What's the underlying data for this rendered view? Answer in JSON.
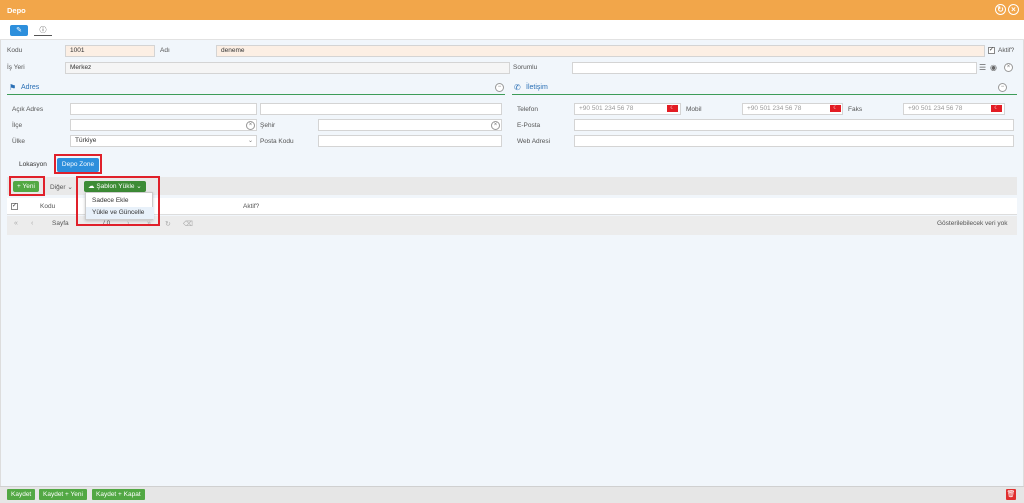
{
  "window": {
    "title": "Depo"
  },
  "form": {
    "kodu_label": "Kodu",
    "kodu_value": "1001",
    "adi_label": "Adı",
    "adi_value": "deneme",
    "aktif_label": "Aktif?",
    "isyeri_label": "İş Yeri",
    "isyeri_value": "Merkez",
    "sorumlu_label": "Sorumlu"
  },
  "adres": {
    "title": "Adres",
    "acik_adres_label": "Açık Adres",
    "ilce_label": "İlçe",
    "sehir_label": "Şehir",
    "ulke_label": "Ülke",
    "ulke_value": "Türkiye",
    "posta_kodu_label": "Posta Kodu"
  },
  "iletisim": {
    "title": "İletişim",
    "telefon_label": "Telefon",
    "mobil_label": "Mobil",
    "faks_label": "Faks",
    "phone_placeholder": "+90 501 234 56 78",
    "eposta_label": "E-Posta",
    "web_label": "Web Adresi"
  },
  "tabs": {
    "lokasyon": "Lokasyon",
    "depo_zone": "Depo Zone"
  },
  "toolbar": {
    "yeni": "Yeni",
    "diger": "Diğer",
    "sablon_yukle": "Şablon Yükle",
    "dropdown_items": [
      "Sadece Ekle",
      "Yükle ve Güncelle"
    ]
  },
  "grid": {
    "columns": [
      "Kodu",
      "Aktif?"
    ],
    "pager_sayfa": "Sayfa",
    "pager_of": "/ 0",
    "empty_text": "Gösterilebilecek veri yok"
  },
  "bottom": {
    "kaydet": "Kaydet",
    "kaydet_yeni": "Kaydet + Yeni",
    "kaydet_kapat": "Kaydet + Kapat"
  },
  "colors": {
    "titlebar": "#f2a64a",
    "accent_blue": "#2d8fdc",
    "green": "#52a844",
    "highlight_red": "#e0202a"
  }
}
